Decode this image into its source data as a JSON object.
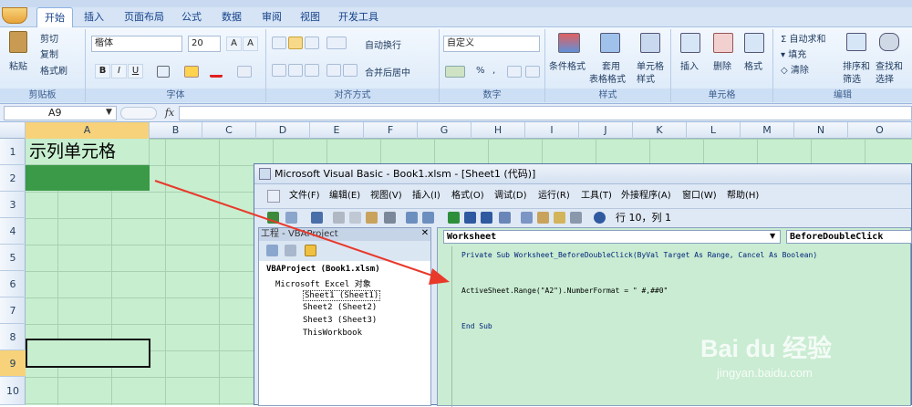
{
  "ribbon": {
    "tabs": [
      "开始",
      "插入",
      "页面布局",
      "公式",
      "数据",
      "审阅",
      "视图",
      "开发工具"
    ],
    "clipboard": {
      "paste": "粘贴",
      "cut": "剪切",
      "copy": "复制",
      "format_painter": "格式刷",
      "label": "剪贴板"
    },
    "font": {
      "name": "楷体",
      "size": "20",
      "bold": "B",
      "italic": "I",
      "underline": "U",
      "label": "字体"
    },
    "alignment": {
      "wrap": "自动换行",
      "merge": "合并后居中",
      "label": "对齐方式"
    },
    "number": {
      "format": "自定义",
      "percent": "%",
      "comma": ",",
      "label": "数字"
    },
    "styles": {
      "conditional": "条件格式",
      "table_a": "套用",
      "table_b": "表格格式",
      "cell_a": "单元格",
      "cell_b": "样式",
      "label": "样式"
    },
    "cells": {
      "insert": "插入",
      "delete": "删除",
      "format": "格式",
      "label": "单元格"
    },
    "editing": {
      "autosum": "自动求和",
      "fill": "填充",
      "clear": "清除",
      "sort_a": "排序和",
      "sort_b": "筛选",
      "find_a": "查找和",
      "find_b": "选择",
      "label": "编辑"
    }
  },
  "formula_bar": {
    "name_box": "A9",
    "fx": "fx"
  },
  "sheet": {
    "columns": [
      "A",
      "B",
      "C",
      "D",
      "E",
      "F",
      "G",
      "H",
      "I",
      "J",
      "K",
      "L",
      "M",
      "N",
      "O"
    ],
    "rows": [
      "1",
      "2",
      "3",
      "4",
      "5",
      "6",
      "7",
      "8",
      "9",
      "10"
    ],
    "a1_text": "示列单元格",
    "selected_cell": "A9",
    "fill_color": "#3a9a47"
  },
  "vbe": {
    "title": "Microsoft Visual Basic - Book1.xlsm - [Sheet1 (代码)]",
    "menu": [
      "文件(F)",
      "编辑(E)",
      "视图(V)",
      "插入(I)",
      "格式(O)",
      "调试(D)",
      "运行(R)",
      "工具(T)",
      "外接程序(A)",
      "窗口(W)",
      "帮助(H)"
    ],
    "position": "行 10，列 1",
    "project_title": "工程 - VBAProject",
    "tree": [
      "VBAProject (Book1.xlsm)",
      "Microsoft Excel 对象",
      "Sheet1 (Sheet1)",
      "Sheet2 (Sheet2)",
      "Sheet3 (Sheet3)",
      "ThisWorkbook"
    ],
    "object_combo": "Worksheet",
    "proc_combo": "BeforeDoubleClick",
    "code": [
      "Private Sub Worksheet_BeforeDoubleClick(ByVal Target As Range, Cancel As Boolean)",
      "ActiveSheet.Range(\"A2\").NumberFormat = \" #,##0\"",
      "End Sub"
    ]
  },
  "watermark": {
    "brand": "Bai du 经验",
    "url": "jingyan.baidu.com"
  },
  "colors": {
    "arrow": "#e8392b",
    "code_bg": "#c9ecd2",
    "ribbon": "#d9e8f8"
  }
}
